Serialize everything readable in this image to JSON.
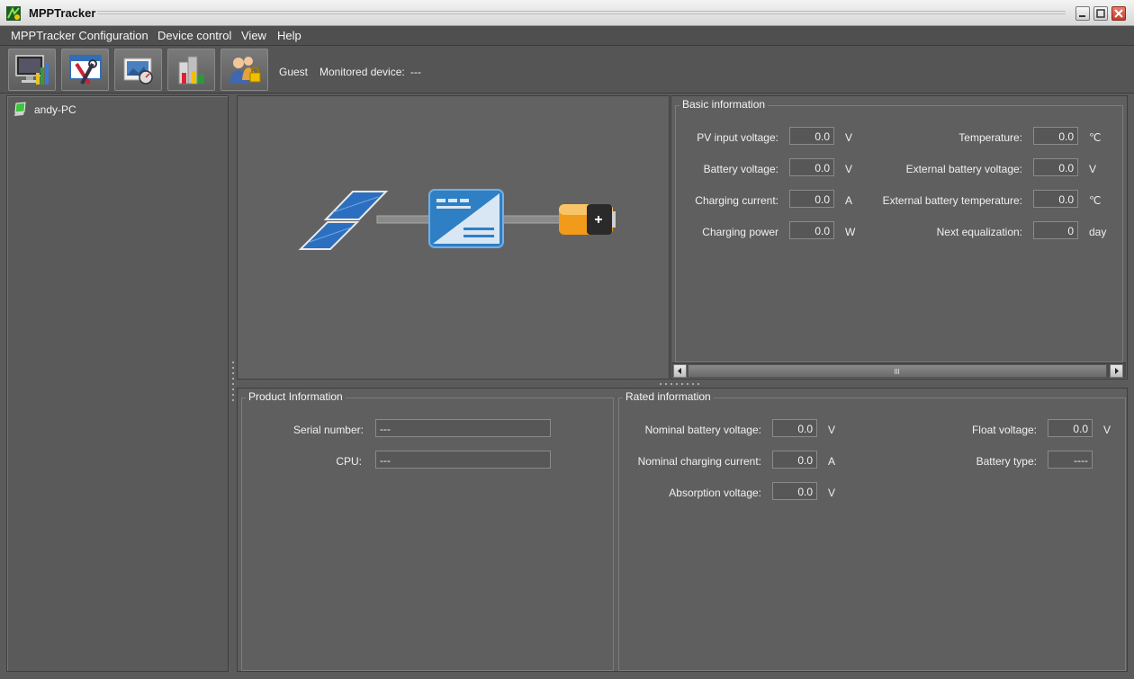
{
  "window": {
    "title": "MPPTracker"
  },
  "menu": [
    "MPPTracker Configuration",
    "Device control",
    "View",
    "Help"
  ],
  "toolbar": {
    "buttons": [
      "monitor-chart-icon",
      "tools-config-icon",
      "photo-gauge-icon",
      "buildings-chart-icon",
      "users-lock-icon"
    ],
    "user": "Guest",
    "monitored_label": "Monitored device:",
    "monitored_value": "---"
  },
  "tree": {
    "node": "andy-PC"
  },
  "basic_info": {
    "title": "Basic information",
    "left": [
      {
        "label": "PV input voltage:",
        "value": "0.0",
        "unit": "V"
      },
      {
        "label": "Battery voltage:",
        "value": "0.0",
        "unit": "V"
      },
      {
        "label": "Charging current:",
        "value": "0.0",
        "unit": "A"
      },
      {
        "label": "Charging power",
        "value": "0.0",
        "unit": "W"
      }
    ],
    "right": [
      {
        "label": "Temperature:",
        "value": "0.0",
        "unit": "℃"
      },
      {
        "label": "External battery voltage:",
        "value": "0.0",
        "unit": "V"
      },
      {
        "label": "External battery temperature:",
        "value": "0.0",
        "unit": "℃"
      },
      {
        "label": "Next equalization:",
        "value": "0",
        "unit": "day"
      }
    ]
  },
  "product_info": {
    "title": "Product Information",
    "serial_label": "Serial number:",
    "serial_value": "---",
    "cpu_label": "CPU:",
    "cpu_value": "---"
  },
  "rated_info": {
    "title": "Rated information",
    "left": [
      {
        "label": "Nominal battery voltage:",
        "value": "0.0",
        "unit": "V"
      },
      {
        "label": "Nominal charging current:",
        "value": "0.0",
        "unit": "A"
      },
      {
        "label": "Absorption voltage:",
        "value": "0.0",
        "unit": "V"
      }
    ],
    "right": [
      {
        "label": "Float voltage:",
        "value": "0.0",
        "unit": "V"
      },
      {
        "label": "Battery type:",
        "value": "----",
        "unit": ""
      }
    ]
  },
  "colors": {
    "background": "#5b5b5b",
    "panel": "#5f5f5f",
    "accent_blue": "#2f7fc4",
    "battery_orange": "#f29a1a"
  }
}
